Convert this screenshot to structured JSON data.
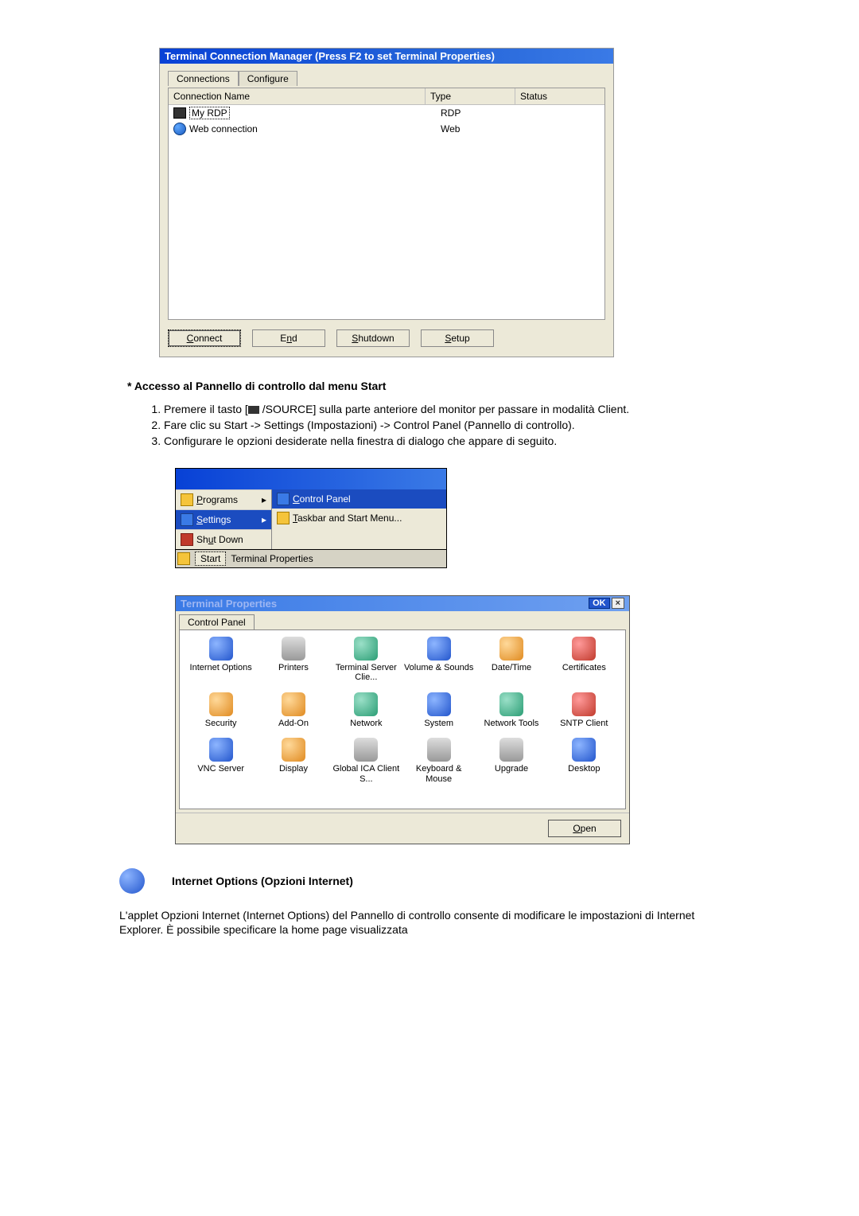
{
  "tcm": {
    "title": "Terminal Connection Manager (Press F2 to set Terminal Properties)",
    "tabs": [
      "Connections",
      "Configure"
    ],
    "cols": {
      "name": "Connection Name",
      "type": "Type",
      "status": "Status"
    },
    "rows": [
      {
        "name": "My RDP",
        "type": "RDP",
        "status": ""
      },
      {
        "name": "Web connection",
        "type": "Web",
        "status": ""
      }
    ],
    "buttons": {
      "connect": "Connect",
      "end": "End",
      "shutdown": "Shutdown",
      "setup": "Setup"
    }
  },
  "section": {
    "title": "* Accesso al Pannello di controllo dal menu Start",
    "steps": [
      "Premere il tasto [■ /SOURCE] sulla parte anteriore del monitor per passare in modalità Client.",
      "Fare clic su Start -> Settings (Impostazioni) -> Control Panel (Pannello di controllo).",
      "Configurare le opzioni desiderate nella finestra di dialogo che appare di seguito."
    ]
  },
  "startmenu": {
    "left": [
      {
        "label": "Programs",
        "selected": false
      },
      {
        "label": "Settings",
        "selected": true
      },
      {
        "label": "Shut Down",
        "selected": false
      }
    ],
    "right": [
      {
        "label": "Control Panel",
        "selected": true
      },
      {
        "label": "Taskbar and Start Menu...",
        "selected": false
      }
    ],
    "taskbar": {
      "start": "Start",
      "task": "Terminal Properties"
    }
  },
  "cp": {
    "title": "Terminal Properties",
    "ok": "OK",
    "tab": "Control Panel",
    "items": [
      {
        "label": "Internet Options",
        "color": "blue"
      },
      {
        "label": "Printers",
        "color": "grey"
      },
      {
        "label": "Terminal Server Clie...",
        "color": "teal"
      },
      {
        "label": "Volume & Sounds",
        "color": "blue"
      },
      {
        "label": "Date/Time",
        "color": "orange"
      },
      {
        "label": "Certificates",
        "color": "red"
      },
      {
        "label": "Security",
        "color": "orange"
      },
      {
        "label": "Add-On",
        "color": "orange"
      },
      {
        "label": "Network",
        "color": "teal"
      },
      {
        "label": "System",
        "color": "blue"
      },
      {
        "label": "Network Tools",
        "color": "teal"
      },
      {
        "label": "SNTP Client",
        "color": "red"
      },
      {
        "label": "VNC Server",
        "color": "blue"
      },
      {
        "label": "Display",
        "color": "orange"
      },
      {
        "label": "Global ICA Client S...",
        "color": "grey"
      },
      {
        "label": "Keyboard & Mouse",
        "color": "grey"
      },
      {
        "label": "Upgrade",
        "color": "grey"
      },
      {
        "label": "Desktop",
        "color": "blue"
      }
    ],
    "open": "Open"
  },
  "io": {
    "heading": "Internet Options (Opzioni Internet)",
    "para": "L'applet Opzioni Internet (Internet Options) del Pannello di controllo consente di modificare le impostazioni di Internet Explorer. È possibile specificare la home page visualizzata"
  }
}
